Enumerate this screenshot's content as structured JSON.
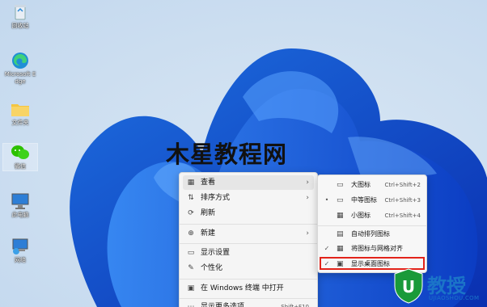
{
  "desktop_icons": [
    {
      "name": "recycle-bin-icon",
      "label": "回收站"
    },
    {
      "name": "edge-icon",
      "label": "Microsoft Edge"
    },
    {
      "name": "folder-icon",
      "label": "文件夹"
    },
    {
      "name": "wechat-icon",
      "label": "微信"
    },
    {
      "name": "computer-icon",
      "label": "此电脑"
    },
    {
      "name": "network-icon",
      "label": "网络"
    }
  ],
  "watermark": "木星教程网",
  "context_menu": {
    "items": [
      {
        "icon": "grid-icon",
        "label": "查看",
        "arrow": "›"
      },
      {
        "icon": "sort-icon",
        "label": "排序方式",
        "arrow": "›"
      },
      {
        "icon": "refresh-icon",
        "label": "刷新"
      },
      {
        "icon": "plus-icon",
        "label": "新建",
        "arrow": "›"
      },
      {
        "icon": "display-icon",
        "label": "显示设置"
      },
      {
        "icon": "brush-icon",
        "label": "个性化"
      },
      {
        "icon": "terminal-icon",
        "label": "在 Windows 终端 中打开"
      },
      {
        "icon": "more-icon",
        "label": "显示更多选项",
        "shortcut": "Shift+F10"
      }
    ]
  },
  "view_submenu": {
    "items": [
      {
        "mark": "",
        "icon": "large-icons-icon",
        "label": "大图标",
        "shortcut": "Ctrl+Shift+2"
      },
      {
        "mark": "•",
        "icon": "medium-icons-icon",
        "label": "中等图标",
        "shortcut": "Ctrl+Shift+3"
      },
      {
        "mark": "",
        "icon": "small-icons-icon",
        "label": "小图标",
        "shortcut": "Ctrl+Shift+4"
      },
      {
        "mark": "",
        "icon": "auto-arrange-icon",
        "label": "自动排列图标",
        "shortcut": ""
      },
      {
        "mark": "✓",
        "icon": "align-grid-icon",
        "label": "将图标与网格对齐",
        "shortcut": ""
      },
      {
        "mark": "✓",
        "icon": "show-desktop-icons-icon",
        "label": "显示桌面图标",
        "shortcut": ""
      }
    ]
  },
  "logo": {
    "letter": "U",
    "word": "教授",
    "url": "UJIAOSHOU.COM"
  },
  "colors": {
    "accent": "#1b74c8",
    "highlight": "#e2231a"
  }
}
